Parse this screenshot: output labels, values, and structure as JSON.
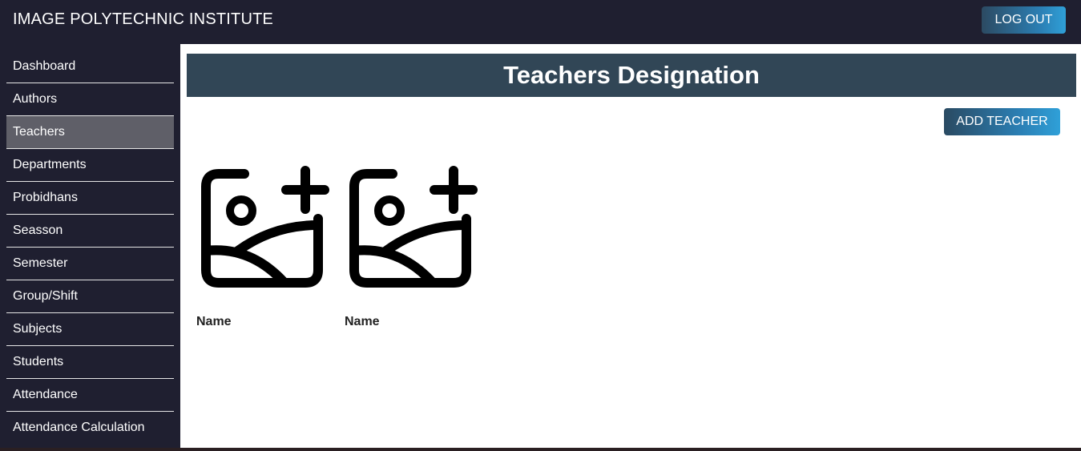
{
  "header": {
    "title": "IMAGE POLYTECHNIC INSTITUTE",
    "logout_label": "LOG OUT"
  },
  "sidebar": {
    "items": [
      {
        "label": "Dashboard"
      },
      {
        "label": "Authors"
      },
      {
        "label": "Teachers",
        "active": true
      },
      {
        "label": "Departments"
      },
      {
        "label": "Probidhans"
      },
      {
        "label": "Seasson"
      },
      {
        "label": "Semester"
      },
      {
        "label": "Group/Shift"
      },
      {
        "label": "Subjects"
      },
      {
        "label": "Students"
      },
      {
        "label": "Attendance"
      },
      {
        "label": "Attendance Calculation"
      }
    ]
  },
  "main": {
    "page_title": "Teachers Designation",
    "add_button_label": "ADD TEACHER",
    "teachers": [
      {
        "name": "Name",
        "photo_icon": "add-photo-icon"
      },
      {
        "name": "Name",
        "photo_icon": "add-photo-icon"
      }
    ]
  },
  "colors": {
    "nav_background": "#1f1f30",
    "active_item": "#5f5f68",
    "title_banner": "#314656",
    "button_gradient_start": "#2a4a62",
    "button_gradient_end": "#2fa0d8"
  }
}
